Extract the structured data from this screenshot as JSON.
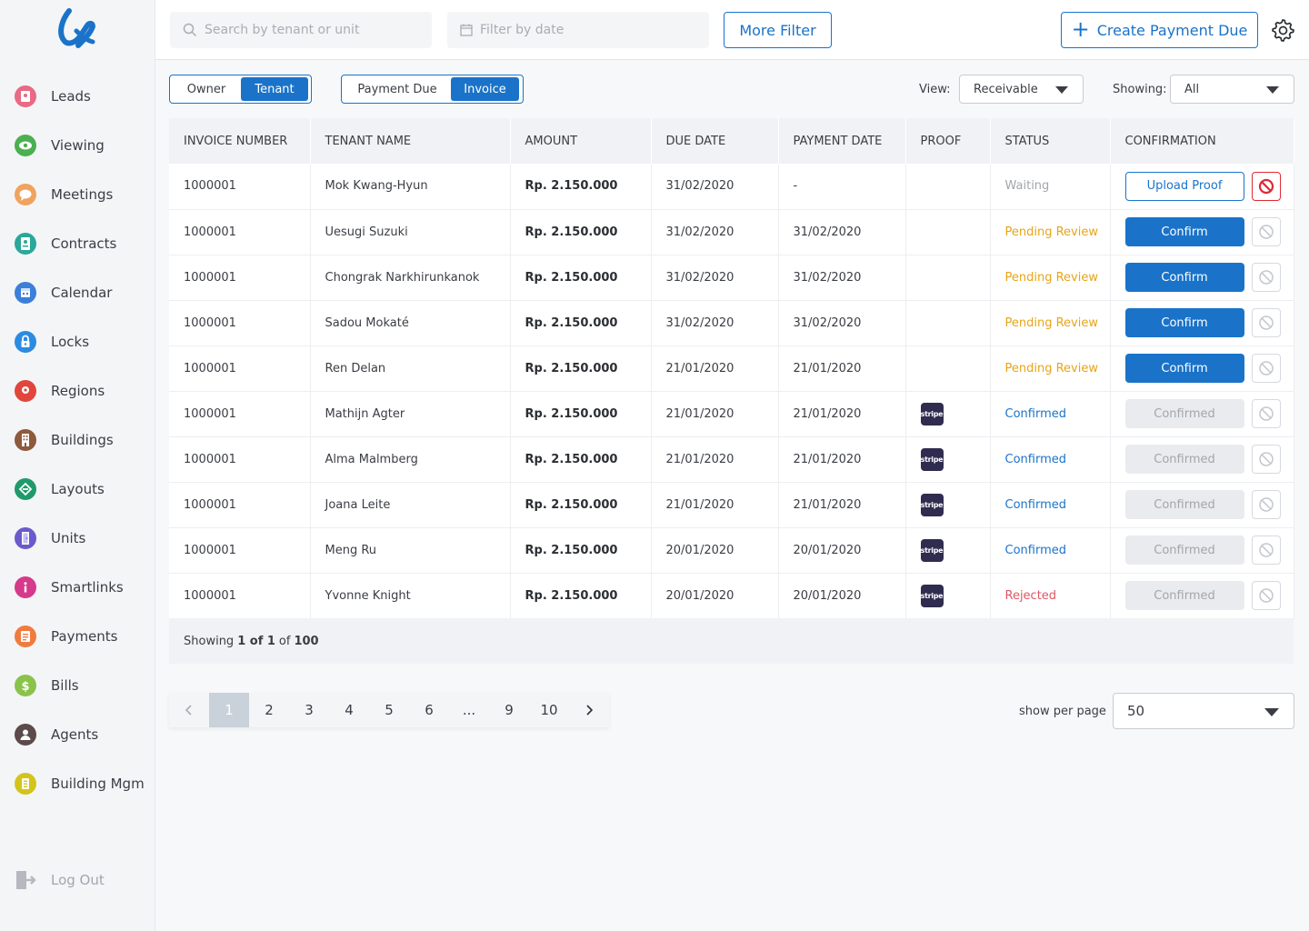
{
  "sidebar": {
    "items": [
      {
        "label": "Leads",
        "icon": "leads-icon",
        "color": "#e86a84"
      },
      {
        "label": "Viewing",
        "icon": "eye-icon",
        "color": "#4caf50"
      },
      {
        "label": "Meetings",
        "icon": "chat-icon",
        "color": "#f0a35e"
      },
      {
        "label": "Contracts",
        "icon": "contract-icon",
        "color": "#2aa89a"
      },
      {
        "label": "Calendar",
        "icon": "calendar-icon",
        "color": "#3b7fd9"
      },
      {
        "label": "Locks",
        "icon": "lock-icon",
        "color": "#2b8be0"
      },
      {
        "label": "Regions",
        "icon": "map-pin-icon",
        "color": "#e0463c"
      },
      {
        "label": "Buildings",
        "icon": "building-icon",
        "color": "#8d5a3b"
      },
      {
        "label": "Layouts",
        "icon": "layout-icon",
        "color": "#1f9b6b"
      },
      {
        "label": "Units",
        "icon": "door-icon",
        "color": "#6a5acd"
      },
      {
        "label": "Smartlinks",
        "icon": "info-icon",
        "color": "#d63a8a"
      },
      {
        "label": "Payments",
        "icon": "payment-icon",
        "color": "#f07b3f"
      },
      {
        "label": "Bills",
        "icon": "dollar-icon",
        "color": "#8bc34a"
      },
      {
        "label": "Agents",
        "icon": "agent-icon",
        "color": "#5d4a4a"
      },
      {
        "label": "Building Mgm",
        "icon": "building-mgm-icon",
        "color": "#d4c419"
      }
    ],
    "logout": "Log Out"
  },
  "topbar": {
    "search_placeholder": "Search by tenant or unit",
    "date_placeholder": "Filter by date",
    "more_filter": "More Filter",
    "create": "Create Payment Due"
  },
  "toggles": {
    "party": {
      "options": [
        "Owner",
        "Tenant"
      ],
      "active": "Tenant"
    },
    "doc": {
      "options": [
        "Payment Due",
        "Invoice"
      ],
      "active": "Invoice"
    }
  },
  "view": {
    "label": "View:",
    "value": "Receivable"
  },
  "showing": {
    "label": "Showing:",
    "value": "All"
  },
  "table": {
    "columns": [
      "INVOICE NUMBER",
      "TENANT NAME",
      "AMOUNT",
      "DUE DATE",
      "PAYMENT DATE",
      "PROOF",
      "STATUS",
      "CONFIRMATION"
    ],
    "rows": [
      {
        "invoice": "1000001",
        "tenant": "Mok Kwang-Hyun",
        "amount": "Rp. 2.150.000",
        "due": "31/02/2020",
        "paid": "-",
        "proof": "",
        "status": "Waiting",
        "status_type": "waiting",
        "action": "Upload Proof",
        "action_type": "upload",
        "reject_active": true
      },
      {
        "invoice": "1000001",
        "tenant": "Uesugi Suzuki",
        "amount": "Rp. 2.150.000",
        "due": "31/02/2020",
        "paid": "31/02/2020",
        "proof": "",
        "status": "Pending Review",
        "status_type": "pending",
        "action": "Confirm",
        "action_type": "confirm",
        "reject_active": false
      },
      {
        "invoice": "1000001",
        "tenant": "Chongrak Narkhirunkanok",
        "amount": "Rp. 2.150.000",
        "due": "31/02/2020",
        "paid": "31/02/2020",
        "proof": "",
        "status": "Pending Review",
        "status_type": "pending",
        "action": "Confirm",
        "action_type": "confirm",
        "reject_active": false
      },
      {
        "invoice": "1000001",
        "tenant": "Sadou Mokaté",
        "amount": "Rp. 2.150.000",
        "due": "31/02/2020",
        "paid": "31/02/2020",
        "proof": "",
        "status": "Pending Review",
        "status_type": "pending",
        "action": "Confirm",
        "action_type": "confirm",
        "reject_active": false
      },
      {
        "invoice": "1000001",
        "tenant": "Ren Delan",
        "amount": "Rp. 2.150.000",
        "due": "21/01/2020",
        "paid": "21/01/2020",
        "proof": "",
        "status": "Pending Review",
        "status_type": "pending",
        "action": "Confirm",
        "action_type": "confirm",
        "reject_active": false
      },
      {
        "invoice": "1000001",
        "tenant": "Mathijn Agter",
        "amount": "Rp. 2.150.000",
        "due": "21/01/2020",
        "paid": "21/01/2020",
        "proof": "stripe",
        "status": "Confirmed",
        "status_type": "confirmed",
        "action": "Confirmed",
        "action_type": "confirmed",
        "reject_active": false
      },
      {
        "invoice": "1000001",
        "tenant": "Alma Malmberg",
        "amount": "Rp. 2.150.000",
        "due": "21/01/2020",
        "paid": "21/01/2020",
        "proof": "stripe",
        "status": "Confirmed",
        "status_type": "confirmed",
        "action": "Confirmed",
        "action_type": "confirmed",
        "reject_active": false
      },
      {
        "invoice": "1000001",
        "tenant": "Joana Leite",
        "amount": "Rp. 2.150.000",
        "due": "21/01/2020",
        "paid": "21/01/2020",
        "proof": "stripe",
        "status": "Confirmed",
        "status_type": "confirmed",
        "action": "Confirmed",
        "action_type": "confirmed",
        "reject_active": false
      },
      {
        "invoice": "1000001",
        "tenant": "Meng Ru",
        "amount": "Rp. 2.150.000",
        "due": "20/01/2020",
        "paid": "20/01/2020",
        "proof": "stripe",
        "status": "Confirmed",
        "status_type": "confirmed",
        "action": "Confirmed",
        "action_type": "confirmed",
        "reject_active": false
      },
      {
        "invoice": "1000001",
        "tenant": "Yvonne Knight",
        "amount": "Rp. 2.150.000",
        "due": "20/01/2020",
        "paid": "20/01/2020",
        "proof": "stripe",
        "status": "Rejected",
        "status_type": "rejected",
        "action": "Confirmed",
        "action_type": "confirmed",
        "reject_active": false
      }
    ],
    "footer": {
      "prefix": "Showing",
      "range": "1 of 1",
      "of": "of",
      "total": "100"
    }
  },
  "pagination": {
    "pages": [
      "1",
      "2",
      "3",
      "4",
      "5",
      "6",
      "...",
      "9",
      "10"
    ],
    "active": "1"
  },
  "per_page": {
    "label": "show per page",
    "value": "50"
  }
}
